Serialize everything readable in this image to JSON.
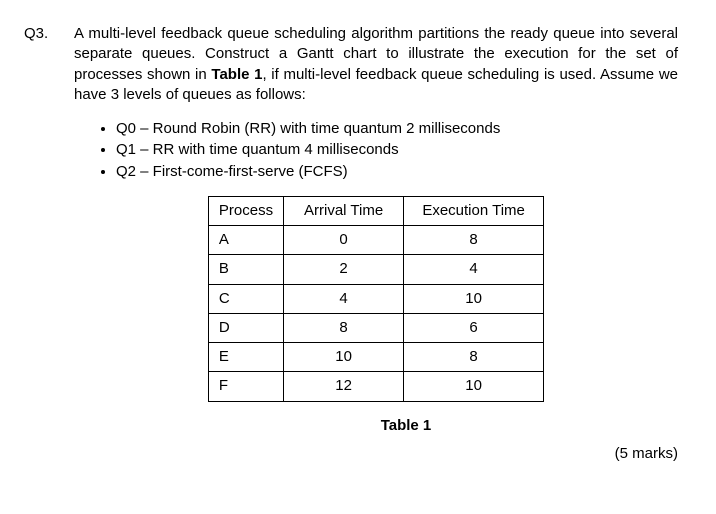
{
  "question": {
    "number": "Q3.",
    "text_parts": {
      "p1": "A multi-level feedback queue scheduling algorithm partitions the ready queue into several separate queues. Construct a Gantt chart to illustrate the execution for the set of processes shown in ",
      "table_ref": "Table 1",
      "p2": ", if multi-level feedback queue scheduling is used. Assume we have 3 levels of queues as follows:"
    },
    "bullets": [
      "Q0 – Round Robin (RR) with time quantum 2 milliseconds",
      "Q1 – RR with time quantum 4 milliseconds",
      "Q2 – First-come-first-serve (FCFS)"
    ],
    "table": {
      "headers": {
        "process": "Process",
        "arrival": "Arrival Time",
        "execution": "Execution Time"
      },
      "rows": [
        {
          "process": "A",
          "arrival": "0",
          "execution": "8"
        },
        {
          "process": "B",
          "arrival": "2",
          "execution": "4"
        },
        {
          "process": "C",
          "arrival": "4",
          "execution": "10"
        },
        {
          "process": "D",
          "arrival": "8",
          "execution": "6"
        },
        {
          "process": "E",
          "arrival": "10",
          "execution": "8"
        },
        {
          "process": "F",
          "arrival": "12",
          "execution": "10"
        }
      ],
      "caption": "Table 1"
    },
    "marks": "(5 marks)"
  }
}
